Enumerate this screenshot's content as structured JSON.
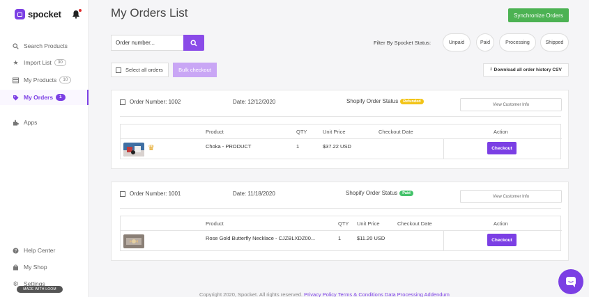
{
  "app": {
    "brand": "spocket"
  },
  "sidebar": {
    "items": [
      {
        "label": "Search Products",
        "icon": "search-icon",
        "badge": ""
      },
      {
        "label": "Import List",
        "icon": "star-icon",
        "badge": "30"
      },
      {
        "label": "My Products",
        "icon": "list-icon",
        "badge": "10"
      },
      {
        "label": "My Orders",
        "icon": "tag-icon",
        "badge": "1"
      },
      {
        "label": "Apps",
        "icon": "puzzle-icon",
        "badge": ""
      }
    ],
    "bottom": [
      {
        "label": "Help Center",
        "icon": "help-icon"
      },
      {
        "label": "My Shop",
        "icon": "shop-icon"
      },
      {
        "label": "Settings",
        "icon": "gear-icon"
      }
    ],
    "magic_badge": "MADE WITH LOOM"
  },
  "header": {
    "title": "My Orders List",
    "sync_label": "Synchronize Orders"
  },
  "search": {
    "placeholder": "Order number...",
    "value": ""
  },
  "filter": {
    "label": "Filter By Spocket Status:",
    "options": [
      "Unpaid",
      "Paid",
      "Processing",
      "Shipped"
    ]
  },
  "bulk": {
    "select_all_label": "Select all orders",
    "bulk_checkout_label": "Bulk checkout",
    "download_label": "Download all order history CSV"
  },
  "table_headers": {
    "product": "Product",
    "qty": "QTY",
    "unit_price": "Unit Price",
    "checkout_date": "Checkout Date",
    "action": "Action"
  },
  "orders": [
    {
      "order_label": "Order Number: 1002",
      "date_label": "Date: 12/12/2020",
      "status_label": "Shopify Order Status",
      "status_badge": "Refunded",
      "view_label": "View Customer Info",
      "product": "Choka - PRODUCT",
      "qty": "1",
      "unit_price": "$37.22 USD",
      "checkout_date": "",
      "checkout_label": "Checkout"
    },
    {
      "order_label": "Order Number: 1001",
      "date_label": "Date: 11/18/2020",
      "status_label": "Shopify Order Status",
      "status_badge": "Paid",
      "view_label": "View Customer Info",
      "product": "Rose Gold Butterfly Necklace - CJZBLXDZ00...",
      "qty": "1",
      "unit_price": "$11.20 USD",
      "checkout_date": "",
      "checkout_label": "Checkout"
    }
  ],
  "footer": {
    "copyright": "Copyright 2020, Spocket. All rights reserved.",
    "links": [
      "Privacy Policy",
      "Terms & Conditions",
      "Data Processing Addendum"
    ]
  },
  "colors": {
    "accent": "#7b3fe4",
    "success": "#4cb253",
    "refunded": "#f2c418",
    "paid": "#44c26a"
  }
}
